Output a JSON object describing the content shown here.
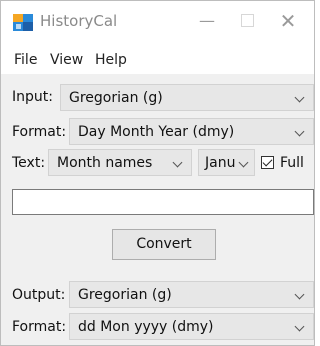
{
  "window": {
    "title": "HistoryCal",
    "controls": {
      "minimize": "—",
      "close": "✕"
    }
  },
  "menu": {
    "file": "File",
    "view": "View",
    "help": "Help"
  },
  "input": {
    "label": "Input:",
    "value": "Gregorian  (g)"
  },
  "input_format": {
    "label": "Format:",
    "value": "Day Month Year  (dmy)"
  },
  "text": {
    "label": "Text:",
    "mode_value": "Month names",
    "month_value": "Janu",
    "full_label": "Full",
    "full_checked": true
  },
  "date_entry": {
    "value": ""
  },
  "convert_button": {
    "label": "Convert"
  },
  "output": {
    "label": "Output:",
    "value": "Gregorian  (g)"
  },
  "output_format": {
    "label": "Format:",
    "value": "dd Mon yyyy  (dmy)"
  }
}
